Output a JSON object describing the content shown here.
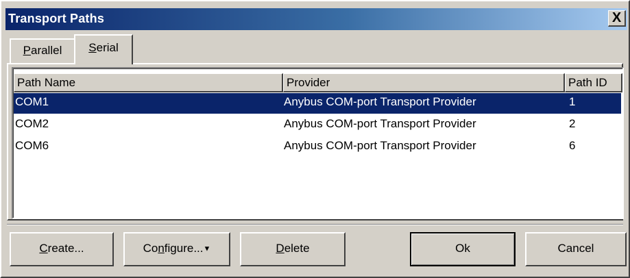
{
  "window": {
    "title": "Transport Paths",
    "close_label": "X"
  },
  "tabs": [
    {
      "mnemonic": "P",
      "rest": "arallel"
    },
    {
      "mnemonic": "S",
      "rest": "erial"
    }
  ],
  "table": {
    "columns": [
      "Path Name",
      "Provider",
      "Path ID"
    ],
    "rows": [
      {
        "name": "COM1",
        "provider": "Anybus COM-port Transport Provider",
        "id": "1",
        "selected": true
      },
      {
        "name": "COM2",
        "provider": "Anybus COM-port Transport Provider",
        "id": "2",
        "selected": false
      },
      {
        "name": "COM6",
        "provider": "Anybus COM-port Transport Provider",
        "id": "6",
        "selected": false
      }
    ]
  },
  "buttons": {
    "create": {
      "mnemonic": "C",
      "rest": "reate..."
    },
    "configure": {
      "pre": "Co",
      "mnemonic": "n",
      "rest": "figure...",
      "dropdown_glyph": "▼"
    },
    "delete": {
      "mnemonic": "D",
      "rest": "elete"
    },
    "ok": "Ok",
    "cancel": "Cancel"
  },
  "colors": {
    "selection": "#0a246a",
    "titlebar_start": "#0a246a",
    "titlebar_end": "#a6caf0",
    "face": "#d4d0c8"
  }
}
